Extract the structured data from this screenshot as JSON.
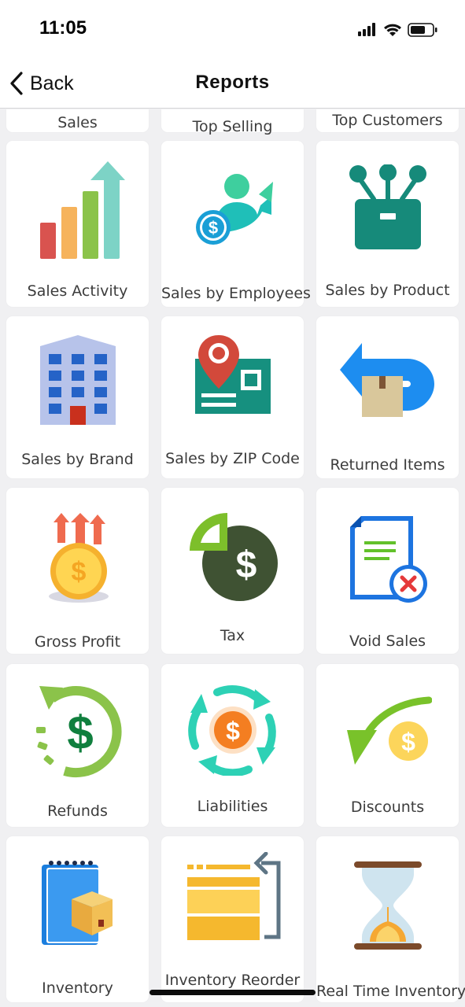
{
  "status_bar": {
    "time": "11:05",
    "icons": [
      "signal-icon",
      "wifi-icon",
      "battery-icon"
    ]
  },
  "nav": {
    "back_label": "Back",
    "title": "Reports"
  },
  "top_partial_tiles": [
    {
      "label": "Sales"
    },
    {
      "label": "Top Selling"
    },
    {
      "label": "Top Customers"
    }
  ],
  "tiles": [
    {
      "label": "Sales Activity",
      "icon": "bar-chart-arrow-icon"
    },
    {
      "label": "Sales by Employees",
      "icon": "employee-dollar-icon"
    },
    {
      "label": "Sales by Product",
      "icon": "product-box-icon"
    },
    {
      "label": "Sales by Brand",
      "icon": "building-icon"
    },
    {
      "label": "Sales by ZIP Code",
      "icon": "zip-location-card-icon"
    },
    {
      "label": "Returned Items",
      "icon": "return-box-icon"
    },
    {
      "label": "Gross Profit",
      "icon": "gold-coin-arrows-icon"
    },
    {
      "label": "Tax",
      "icon": "tax-pie-dollar-icon"
    },
    {
      "label": "Void Sales",
      "icon": "void-document-icon"
    },
    {
      "label": "Refunds",
      "icon": "refund-dollar-icon"
    },
    {
      "label": "Liabilities",
      "icon": "liabilities-cycle-icon"
    },
    {
      "label": "Discounts",
      "icon": "discount-arrow-coin-icon"
    },
    {
      "label": "Inventory",
      "icon": "inventory-notebook-box-icon"
    },
    {
      "label": "Inventory Reorder",
      "icon": "reorder-list-icon"
    },
    {
      "label": "Real Time Inventory",
      "icon": "hourglass-icon"
    }
  ],
  "colors": {
    "background": "#f0f0f2",
    "tile": "#ffffff",
    "label_text": "#3c3c3c"
  }
}
